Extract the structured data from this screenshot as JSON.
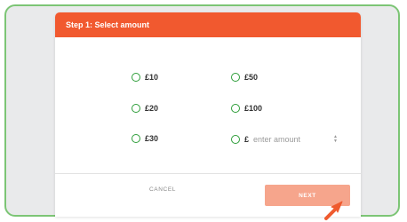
{
  "dialog": {
    "header_title": "Step 1: Select amount",
    "header_color": "#f1592f"
  },
  "amount_options": [
    {
      "label": "£10"
    },
    {
      "label": "£50"
    },
    {
      "label": "£20"
    },
    {
      "label": "£100"
    },
    {
      "label": "£30"
    }
  ],
  "custom_amount": {
    "currency_symbol": "£",
    "placeholder": "enter amount",
    "value": ""
  },
  "footer": {
    "cancel_label": "CANCEL",
    "next_label": "NEXT"
  },
  "colors": {
    "frame_border": "#7cc575",
    "radio_border": "#2e9e3a",
    "next_button": "#f6a58c"
  }
}
